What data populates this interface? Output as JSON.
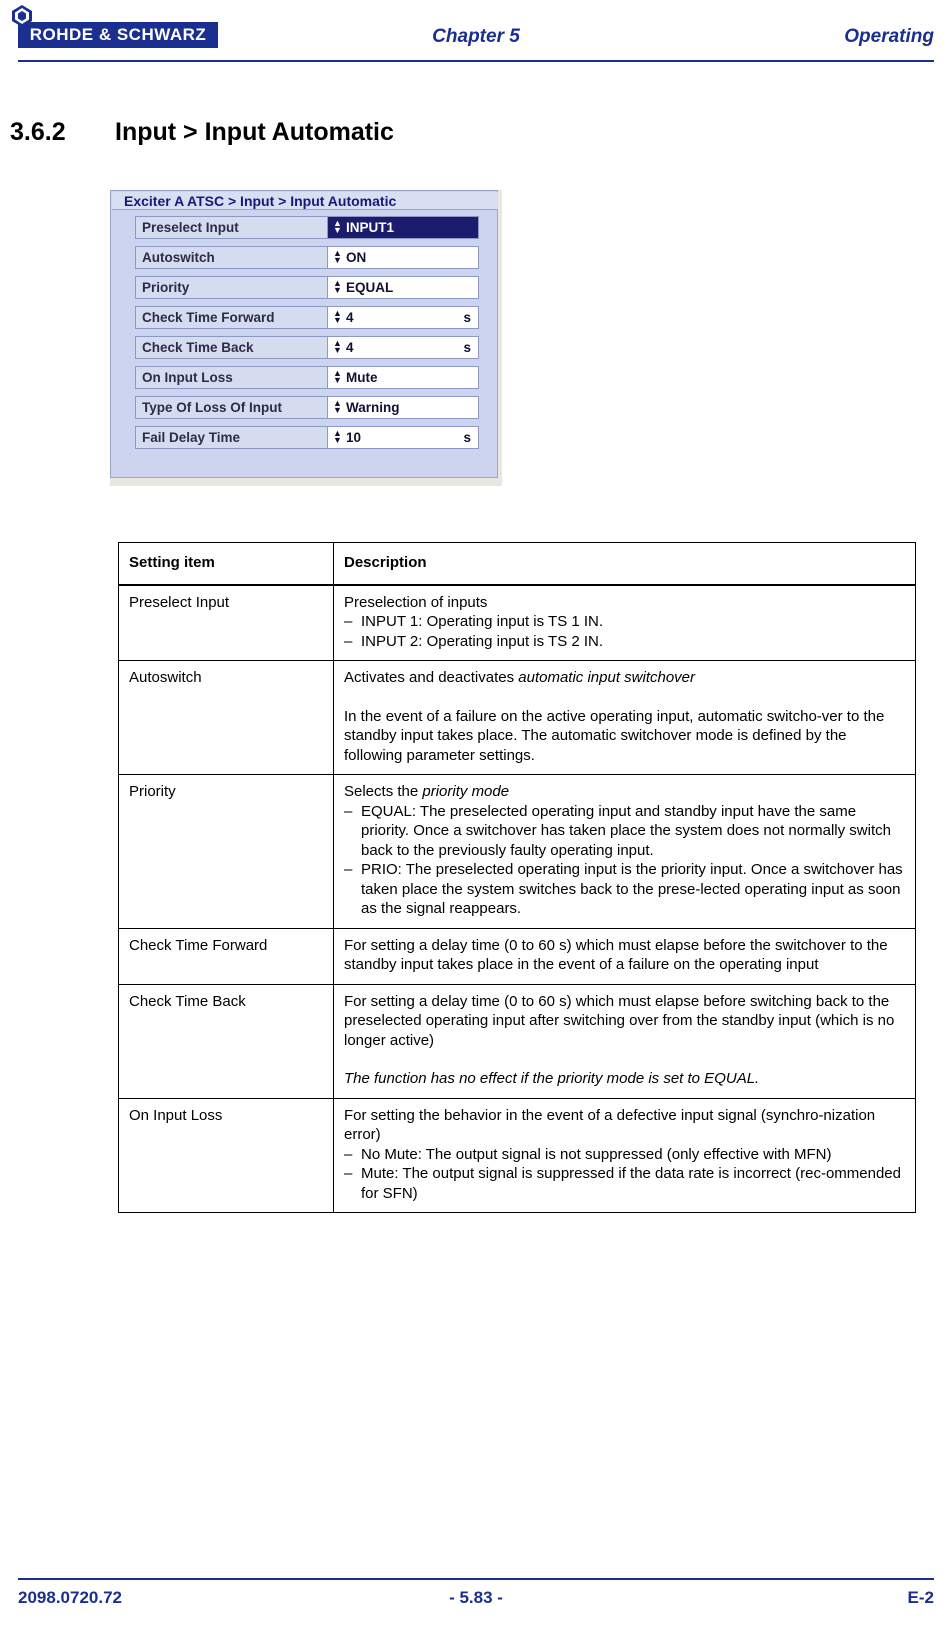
{
  "header": {
    "logo_text": "ROHDE & SCHWARZ",
    "chapter": "Chapter 5",
    "right": "Operating"
  },
  "section": {
    "number": "3.6.2",
    "title": "Input > Input Automatic"
  },
  "screenshot": {
    "title": "Exciter A ATSC  > Input > Input Automatic",
    "rows": [
      {
        "label": "Preselect Input",
        "value": "INPUT1",
        "unit": "",
        "selected": true
      },
      {
        "label": "Autoswitch",
        "value": "ON",
        "unit": "",
        "selected": false
      },
      {
        "label": "Priority",
        "value": "EQUAL",
        "unit": "",
        "selected": false
      },
      {
        "label": "Check Time Forward",
        "value": "4",
        "unit": "s",
        "selected": false
      },
      {
        "label": "Check Time Back",
        "value": "4",
        "unit": "s",
        "selected": false
      },
      {
        "label": "On Input Loss",
        "value": "Mute",
        "unit": "",
        "selected": false
      },
      {
        "label": "Type Of Loss Of Input",
        "value": "Warning",
        "unit": "",
        "selected": false
      },
      {
        "label": "Fail Delay Time",
        "value": "10",
        "unit": "s",
        "selected": false
      }
    ]
  },
  "table": {
    "headers": {
      "col1": "Setting item",
      "col2": "Description"
    },
    "rows": [
      {
        "item": "Preselect Input",
        "intro": "Preselection of inputs",
        "bullets": [
          "INPUT 1: Operating input is TS 1 IN.",
          "INPUT 2: Operating input is TS 2 IN."
        ]
      },
      {
        "item": "Autoswitch",
        "intro_plain": "Activates and deactivates ",
        "intro_italic": "automatic input switchover",
        "para2": "In the event of a failure on the active operating input, automatic switcho-ver to the standby input takes place. The automatic switchover mode is defined by the following parameter settings."
      },
      {
        "item": "Priority",
        "intro_plain": "Selects the ",
        "intro_italic": "priority mode",
        "bullets": [
          "EQUAL: The preselected operating input and standby input have the same priority. Once a switchover has taken place the system does not normally switch back to the previously faulty operating input.",
          "PRIO: The preselected operating input is the priority input. Once a switchover has taken place the system switches back to the prese-lected operating input as soon as the signal reappears."
        ]
      },
      {
        "item": "Check Time Forward",
        "intro": "For setting a delay time (0 to 60 s) which must elapse before the switchover to the standby input takes place in the event of a failure on the operating input"
      },
      {
        "item": "Check Time Back",
        "intro": "For setting a delay time (0 to 60 s) which must elapse before switching back to the preselected operating input after switching over from the standby input (which is no longer active)",
        "para2_italic": "The function has no effect if the priority mode is set to EQUAL."
      },
      {
        "item": "On Input Loss",
        "intro": "For setting the behavior in the event of a defective input signal (synchro-nization error)",
        "bullets": [
          "No Mute: The output signal is not suppressed (only effective with MFN)",
          "Mute: The output signal is suppressed if the data rate is incorrect (rec-ommended for SFN)"
        ]
      }
    ]
  },
  "footer": {
    "left": "2098.0720.72",
    "center": "- 5.83 -",
    "right": "E-2"
  }
}
